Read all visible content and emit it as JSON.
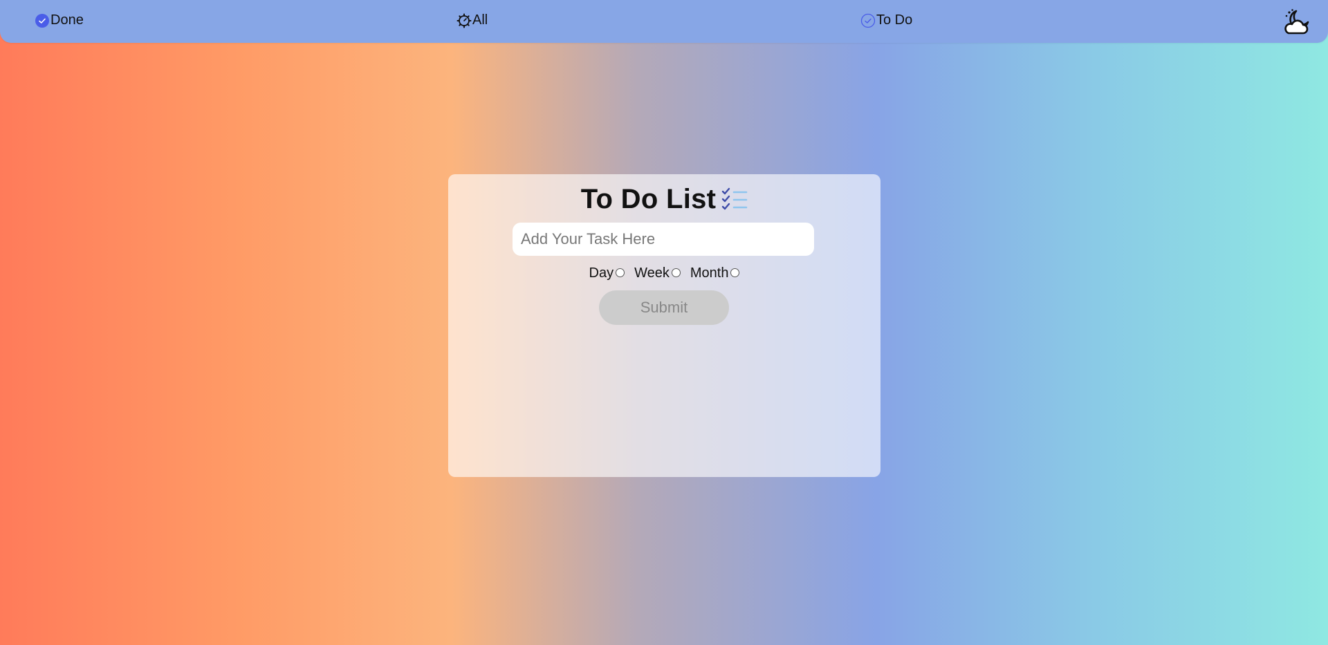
{
  "nav": {
    "done_label": "Done",
    "all_label": "All",
    "todo_label": "To Do"
  },
  "card": {
    "title": "To Do List",
    "input_placeholder": "Add Your Task Here",
    "input_value": "",
    "period_options": [
      "Day",
      "Week",
      "Month"
    ],
    "submit_label": "Submit"
  },
  "colors": {
    "topbar": "#87a6e6",
    "accent": "#4a5de8",
    "submit_disabled": "#cccccc"
  },
  "icons": {
    "done": "check-circle-filled-icon",
    "all": "gear-icon",
    "todo": "check-circle-outline-icon",
    "theme": "moon-cloud-icon",
    "title": "checklist-icon"
  }
}
